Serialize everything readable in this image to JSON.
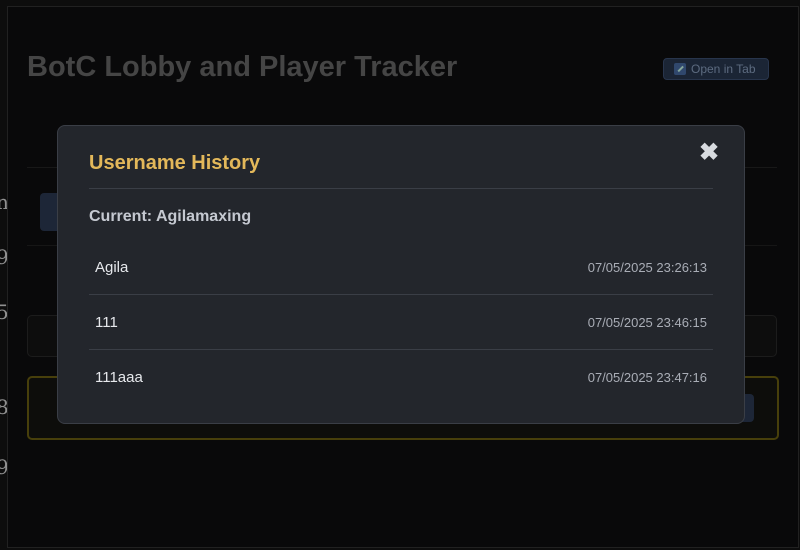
{
  "app": {
    "title": "BotC Lobby and Player Tracker",
    "open_in_tab_label": "Open in Tab"
  },
  "modal": {
    "title": "Username History",
    "close_symbol": "✖",
    "current_label": "Current: Agilamaxing",
    "history": [
      {
        "name": "Agila",
        "timestamp": "07/05/2025 23:26:13"
      },
      {
        "name": "111",
        "timestamp": "07/05/2025 23:46:15"
      },
      {
        "name": "111aaa",
        "timestamp": "07/05/2025 23:47:16"
      }
    ]
  },
  "colors": {
    "modal_title": "#e3b85a",
    "modal_bg": "#23262c",
    "card_highlight": "#6e6212"
  }
}
